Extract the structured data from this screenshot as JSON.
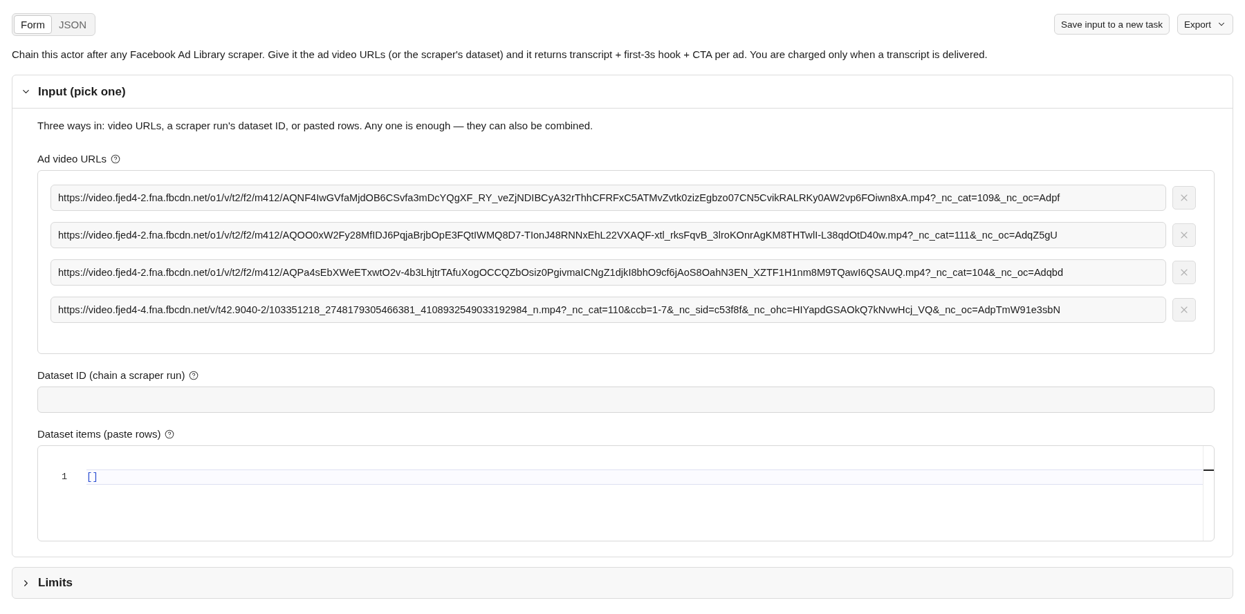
{
  "view_toggle": [
    {
      "label": "Form",
      "selected": true
    },
    {
      "label": "JSON",
      "selected": false
    }
  ],
  "actions": [
    {
      "label": "Save input to a new task",
      "kind": "button"
    },
    {
      "label": "Export",
      "kind": "dropdown"
    }
  ],
  "description": "Chain this actor after any Facebook Ad Library scraper. Give it the ad video URLs (or the scraper's dataset) and it returns transcript + first-3s hook + CTA per ad. You are charged only when a transcript is delivered.",
  "sections": [
    {
      "title": "Input (pick one)",
      "expanded": true,
      "intro": "Three ways in: video URLs, a scraper run's dataset ID, or pasted rows. Any one is enough — they can also be combined.",
      "fields": [
        {
          "kind": "url_list",
          "label": "Ad video URLs",
          "values": [
            "https://video.fjed4-2.fna.fbcdn.net/o1/v/t2/f2/m412/AQNF4IwGVfaMjdOB6CSvfa3mDcYQgXF_RY_veZjNDIBCyA32rThhCFRFxC5ATMvZvtk0zizEgbzo07CN5CvikRALRKy0AW2vp6FOiwn8xA.mp4?_nc_cat=109&_nc_oc=Adpf",
            "https://video.fjed4-2.fna.fbcdn.net/o1/v/t2/f2/m412/AQOO0xW2Fy28MfIDJ6PqjaBrjbOpE3FQtIWMQ8D7-TIonJ48RNNxEhL22VXAQF-xtl_rksFqvB_3lroKOnrAgKM8THTwlI-L38qdOtD40w.mp4?_nc_cat=111&_nc_oc=AdqZ5gU",
            "https://video.fjed4-2.fna.fbcdn.net/o1/v/t2/f2/m412/AQPa4sEbXWeETxwtO2v-4b3LhjtrTAfuXogOCCQZbOsiz0PgivmaICNgZ1djkI8bhO9cf6jAoS8OahN3EN_XZTF1H1nm8M9TQawI6QSAUQ.mp4?_nc_cat=104&_nc_oc=Adqbd",
            "https://video.fjed4-4.fna.fbcdn.net/v/t42.9040-2/103351218_2748179305466381_4108932549033192984_n.mp4?_nc_cat=110&ccb=1-7&_nc_sid=c53f8f&_nc_ohc=HIYapdGSAOkQ7kNvwHcj_VQ&_nc_oc=AdpTmW91e3sbN"
          ]
        },
        {
          "kind": "text",
          "label": "Dataset ID (chain a scraper run)"
        },
        {
          "kind": "code",
          "label": "Dataset items (paste rows)",
          "lines": [
            {
              "number": "1",
              "text": "[]"
            }
          ]
        }
      ]
    },
    {
      "title": "Limits",
      "expanded": false
    }
  ]
}
